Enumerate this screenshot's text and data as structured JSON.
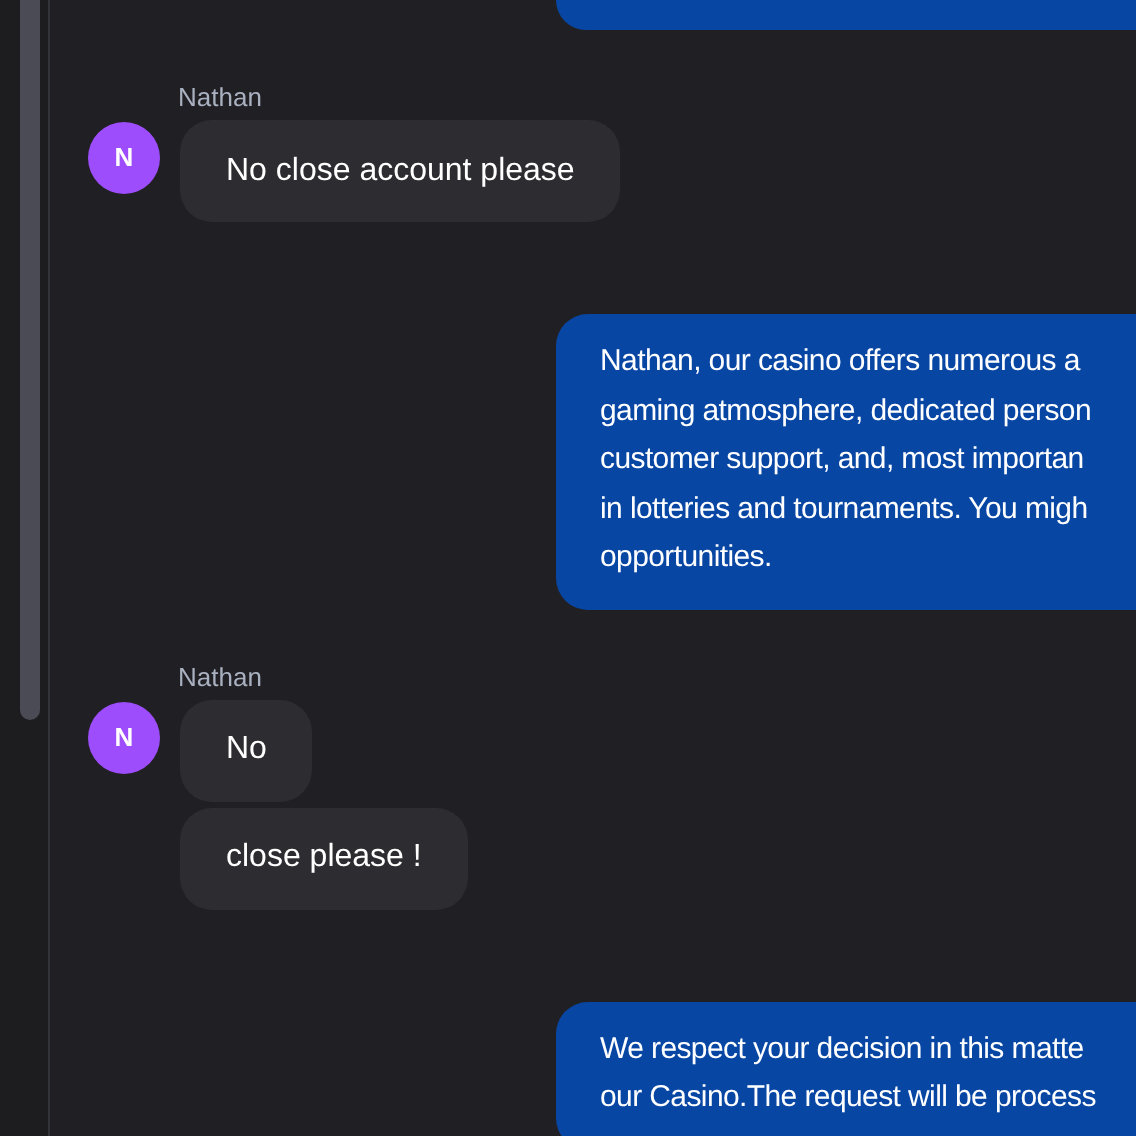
{
  "messages": [
    {
      "kind": "agent"
    },
    {
      "kind": "user",
      "sender": "Nathan",
      "avatar": "N",
      "bubbles": [
        "No close account please"
      ]
    },
    {
      "kind": "agent",
      "lines": [
        "Nathan, our casino offers numerous a",
        "gaming atmosphere, dedicated person",
        "customer support, and, most importan",
        "in lotteries and tournaments. You migh",
        "opportunities."
      ]
    },
    {
      "kind": "user",
      "sender": "Nathan",
      "avatar": "N",
      "bubbles": [
        "No",
        "close please !"
      ]
    },
    {
      "kind": "agent",
      "lines": [
        "We respect your decision in this matte",
        "our Casino.The request will be process"
      ]
    }
  ]
}
